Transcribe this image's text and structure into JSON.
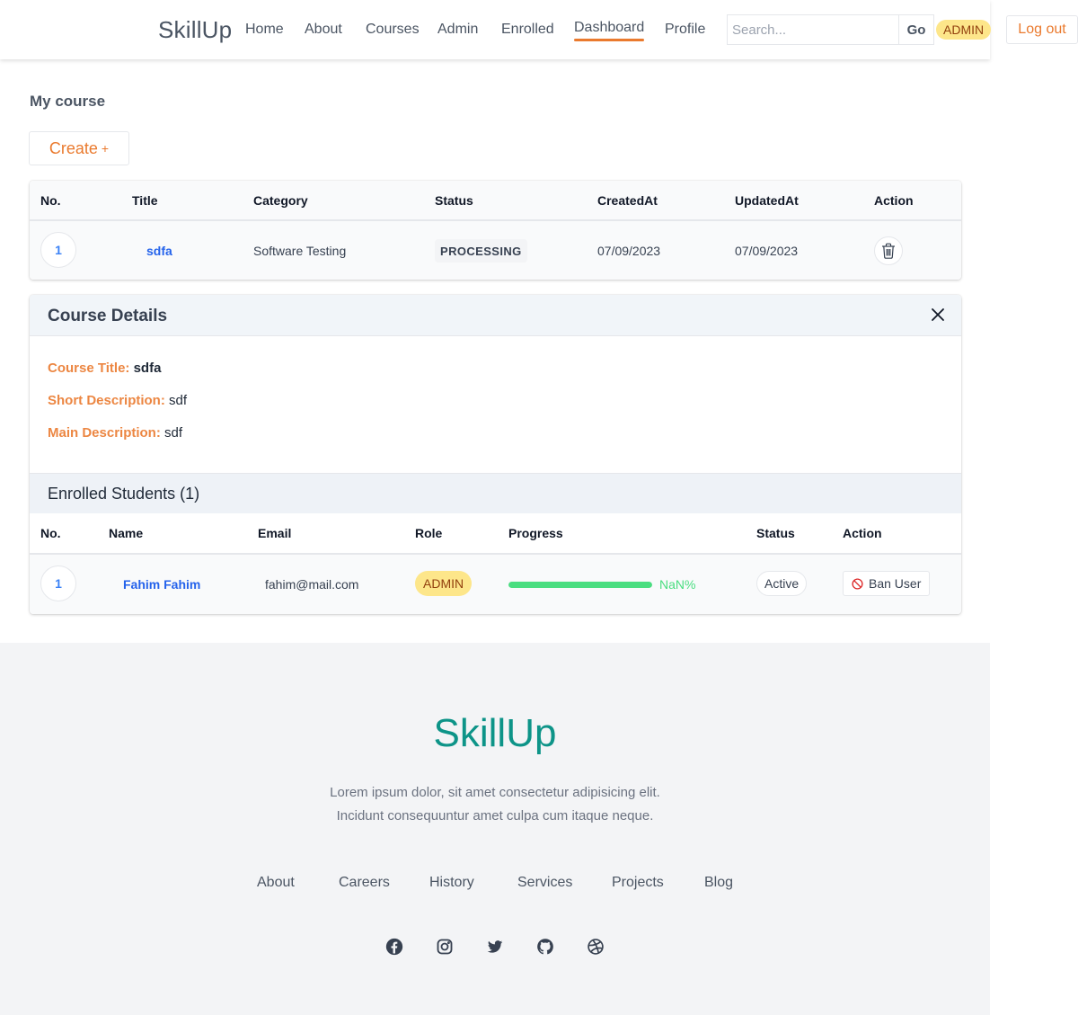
{
  "header": {
    "brand": "SkillUp",
    "nav": {
      "home": "Home",
      "about": "About",
      "courses": "Courses",
      "admin": "Admin",
      "enrolled": "Enrolled",
      "dashboard": "Dashboard",
      "profile": "Profile"
    },
    "active_nav": "Dashboard",
    "search": {
      "placeholder": "Search...",
      "value": "",
      "button_label": "Go"
    },
    "role_badge": "ADMIN",
    "logout_label": "Log out",
    "accent_color": "#ea7a2e"
  },
  "main": {
    "section_title": "My course",
    "create_label": "Create",
    "create_icon": "+",
    "courses_table": {
      "columns": [
        "No.",
        "Title",
        "Category",
        "Status",
        "CreatedAt",
        "UpdatedAt",
        "Action"
      ],
      "rows": [
        {
          "no": "1",
          "title": "sdfa",
          "category": "Software Testing",
          "status": "PROCESSING",
          "created_at": "07/09/2023",
          "updated_at": "07/09/2023",
          "action_icon": "trash-icon"
        }
      ]
    },
    "details": {
      "title": "Course Details",
      "close_icon": "close-icon",
      "fields": [
        {
          "label": "Course Title:",
          "value": "sdfa"
        },
        {
          "label": "Short Description:",
          "value": "sdf"
        },
        {
          "label": "Main Description:",
          "value": "sdf"
        }
      ],
      "enrolled_title": "Enrolled Students (1)",
      "students_table": {
        "columns": [
          "No.",
          "Name",
          "Email",
          "Role",
          "Progress",
          "Status",
          "Action"
        ],
        "rows": [
          {
            "no": "1",
            "name": "Fahim Fahim",
            "email": "fahim@mail.com",
            "role": "ADMIN",
            "progress_fill": 1.0,
            "progress_text": "NaN%",
            "status": "Active",
            "action_label": "Ban User",
            "action_icon": "ban-icon"
          }
        ]
      }
    }
  },
  "footer": {
    "brand": "SkillUp",
    "brand_color": "#0d9488",
    "text_line1": "Lorem ipsum dolor, sit amet consectetur adipisicing elit.",
    "text_line2": "Incidunt consequuntur amet culpa cum itaque neque.",
    "links": [
      "About",
      "Careers",
      "History",
      "Services",
      "Projects",
      "Blog"
    ],
    "social_icons": [
      "facebook-icon",
      "instagram-icon",
      "twitter-icon",
      "github-icon",
      "dribbble-icon"
    ]
  }
}
